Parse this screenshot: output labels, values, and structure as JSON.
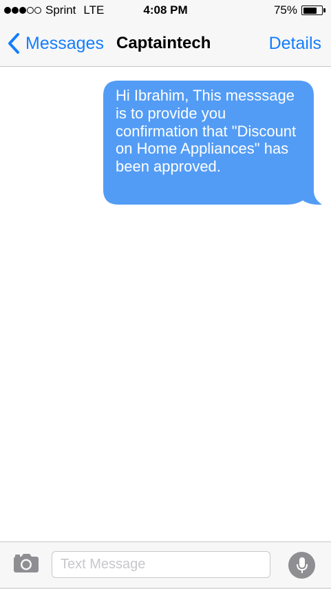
{
  "status_bar": {
    "carrier": "Sprint",
    "network": "LTE",
    "signal_bars_filled": 3,
    "signal_bars_total": 5,
    "time": "4:08 PM",
    "battery_percent": "75%",
    "battery_level": 0.75
  },
  "nav": {
    "back_label": "Messages",
    "title": "Captaintech",
    "details_label": "Details"
  },
  "conversation": {
    "messages": [
      {
        "direction": "outgoing",
        "text": "Hi Ibrahim, This messsage is to provide you confirmation that \"Discount on Home Appliances\" has been approved."
      }
    ]
  },
  "input_bar": {
    "placeholder": "Text Message",
    "value": ""
  },
  "colors": {
    "accent": "#147efb",
    "bubble": "#539cf5",
    "bar_background": "#f7f7f8",
    "icon_gray": "#8e8e93"
  },
  "icons": {
    "back": "chevron-left-icon",
    "camera": "camera-icon",
    "mic": "microphone-icon"
  }
}
